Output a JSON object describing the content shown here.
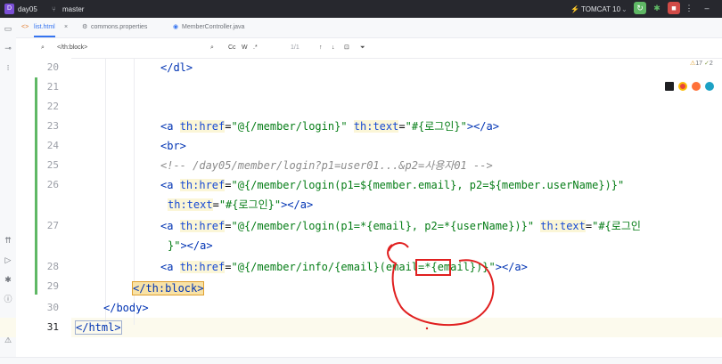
{
  "titlebar": {
    "project_badge": "D",
    "project": "day05",
    "branch": "master",
    "run_config": "TOMCAT 10"
  },
  "tabs": [
    {
      "label": "list.html",
      "active": true
    },
    {
      "label": "commons.properties",
      "active": false
    },
    {
      "label": "MemberController.java",
      "active": false
    }
  ],
  "find": {
    "query": "</th:block>",
    "case_label": "Cc",
    "word_label": "W",
    "regex_label": ".*",
    "match_count": "1/1"
  },
  "inspection": {
    "warnings": "17",
    "weak_warnings": "2"
  },
  "lines": [
    {
      "num": "20"
    },
    {
      "num": "21"
    },
    {
      "num": "22"
    },
    {
      "num": "23"
    },
    {
      "num": "24"
    },
    {
      "num": "25"
    },
    {
      "num": "26"
    },
    {
      "num": "27"
    },
    {
      "num": "28"
    },
    {
      "num": "29"
    },
    {
      "num": "30"
    },
    {
      "num": "31"
    }
  ],
  "code": {
    "l20_tag": "</dl>",
    "l23_open": "<a",
    "l23_attr1": "th:href",
    "l23_eq1": "=",
    "l23_val1": "\"@{/member/login}\"",
    "l23_attr2": "th:text",
    "l23_eq2": "=",
    "l23_val2": "\"#{로그인}\"",
    "l23_close": "></a>",
    "l24_tag": "<br>",
    "l25_comment": "<!-- /day05/member/login?p1=user01...&p2=사용자01 -->",
    "l26_open": "<a",
    "l26_attr1": "th:href",
    "l26_eq1": "=",
    "l26_val1": "\"@{/member/login(p1=${member.email}, p2=${member.userName})}\"",
    "l26b_attr2": "th:text",
    "l26b_eq2": "=",
    "l26b_val2": "\"#{로그인}\"",
    "l26b_close": "></a>",
    "l27_open": "<a",
    "l27_attr1": "th:href",
    "l27_eq1": "=",
    "l27_val1": "\"@{/member/login(p1=*{email}, p2=*{userName})}\"",
    "l27_attr2": "th:text",
    "l27_eq2": "=",
    "l27_val2a": "\"#{로그인",
    "l27b_val2b": "}\"",
    "l27b_close": "></a>",
    "l28_open": "<a",
    "l28_attr1": "th:href",
    "l28_eq1": "=",
    "l28_val1": "\"@{/member/info/{email}(email=*{email})}\"",
    "l28_close": "></a>",
    "l29_tag": "</th:block>",
    "l30_tag": "</body>",
    "l31_tag": "</html>"
  },
  "colors": {
    "accent": "#3574f0",
    "tag": "#0033b3",
    "string": "#067d17",
    "comment": "#8c8c8c",
    "annotation_red": "#e02020",
    "vcs_added": "#5fb865"
  },
  "icons": {
    "run": "run-icon",
    "debug": "debug-icon",
    "stop": "stop-icon",
    "search": "search-icon",
    "more": "more-icon"
  }
}
